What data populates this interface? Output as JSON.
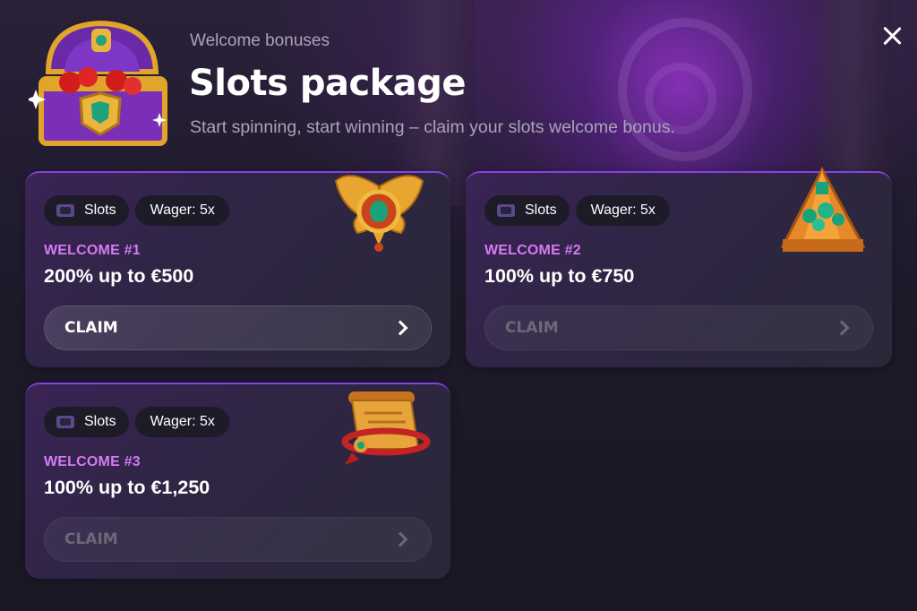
{
  "header": {
    "kicker": "Welcome bonuses",
    "title": "Slots package",
    "subtitle": "Start spinning, start winning – claim your slots welcome bonus."
  },
  "colors": {
    "accent_purple": "#8a3ee6",
    "welcome_label": "#d57af3",
    "card_bg": "#2f2544",
    "chip_bg": "#1e1b29",
    "muted_text": "#a9a4b8"
  },
  "icons": {
    "close": "close-icon",
    "header": "treasure-chest-icon",
    "chip": "slot-machine-icon",
    "claim": "chevron-right-icon"
  },
  "offers": [
    {
      "chip_category": "Slots",
      "chip_wager": "Wager: 5x",
      "label": "WELCOME #1",
      "offer": "200% up to €500",
      "claim": "CLAIM",
      "claim_enabled": true,
      "art": "winged-scarab-amulet-icon"
    },
    {
      "chip_category": "Slots",
      "chip_wager": "Wager: 5x",
      "label": "WELCOME #2",
      "offer": "100% up to €750",
      "claim": "CLAIM",
      "claim_enabled": false,
      "art": "golden-pyramid-gems-icon"
    },
    {
      "chip_category": "Slots",
      "chip_wager": "Wager: 5x",
      "label": "WELCOME #3",
      "offer": "100% up to €1,250",
      "claim": "CLAIM",
      "claim_enabled": false,
      "art": "ancient-scroll-icon"
    }
  ]
}
